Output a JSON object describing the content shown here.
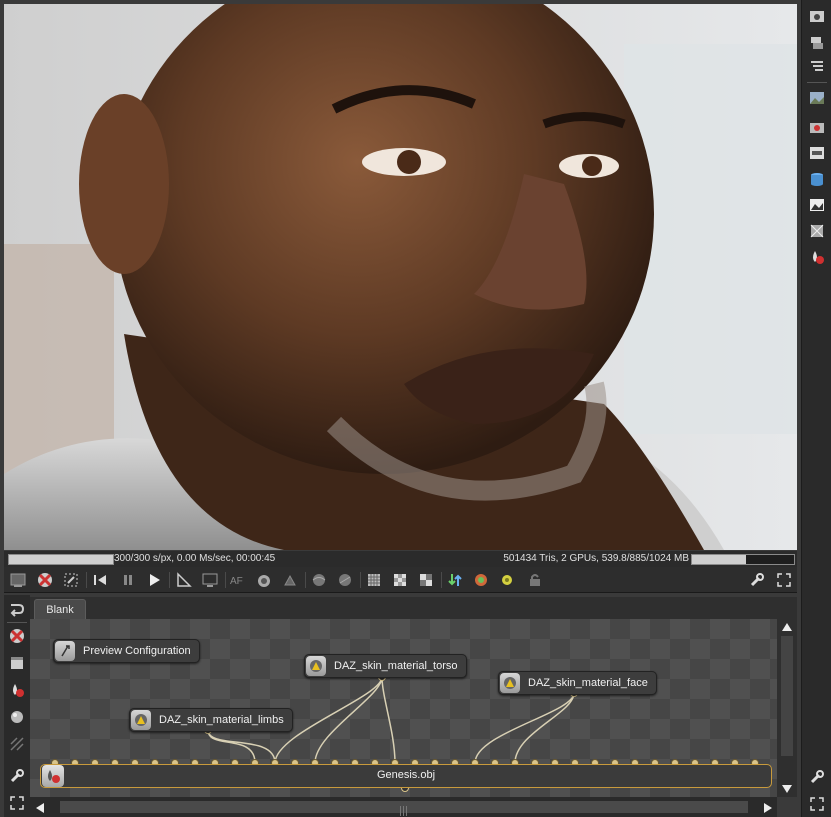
{
  "viewport": {
    "image": "render-portrait"
  },
  "status": {
    "left": "300/300 s/px, 0.00 Ms/sec, 00:00:45",
    "right": "501434 Tris, 2 GPUs, 539.8/885/1024 MB",
    "left_progress": 1.0,
    "right_progress": 0.53
  },
  "graph": {
    "tab": "Blank",
    "nodes": {
      "preview": "Preview Configuration",
      "limbs": "DAZ_skin_material_limbs",
      "torso": "DAZ_skin_material_torso",
      "face": "DAZ_skin_material_face",
      "genesis": "Genesis.obj"
    }
  },
  "colors": {
    "accent": "#c89a3c",
    "pin": "#d9c48a",
    "wire": "#d8d0b4"
  }
}
